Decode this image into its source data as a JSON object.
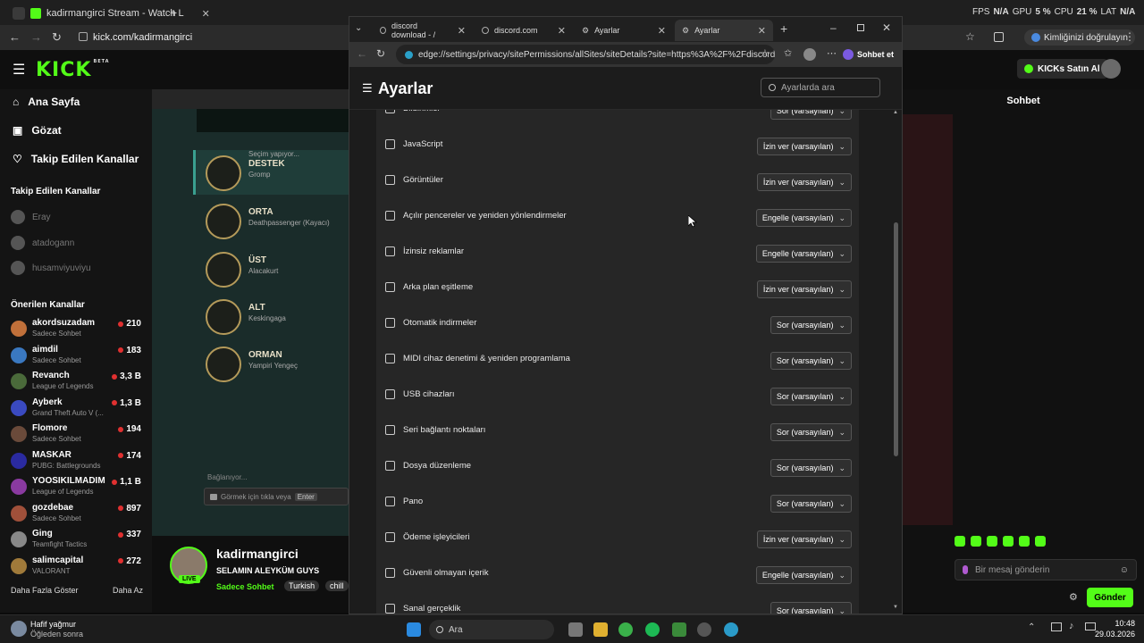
{
  "back_browser": {
    "tab_title": "kadirmangirci Stream - Watch L",
    "url": "kick.com/kadirmangirci",
    "perf": {
      "fps_label": "FPS",
      "fps_value": "N/A",
      "gpu_label": "GPU",
      "gpu_value": "5 %",
      "cpu_label": "CPU",
      "cpu_value": "21 %",
      "lat_label": "LAT",
      "lat_value": "N/A"
    },
    "identity_button": "Kimliğinizi doğrulayın"
  },
  "kick": {
    "logo": "KICK",
    "logo_sup": "BETA",
    "nav": {
      "home": "Ana Sayfa",
      "browse": "Gözat",
      "following": "Takip Edilen Kanallar"
    },
    "followed_title": "Takip Edilen Kanallar",
    "followed": [
      "Eray",
      "atadogann",
      "husamviyuviyu"
    ],
    "recommended_title": "Önerilen Kanallar",
    "recommended": [
      {
        "name": "akordsuzadam",
        "game": "Sadece Sohbet",
        "viewers": "210",
        "color": "#c0703a"
      },
      {
        "name": "aimdil",
        "game": "Sadece Sohbet",
        "viewers": "183",
        "color": "#3a78c0"
      },
      {
        "name": "Revanch",
        "game": "League of Legends",
        "viewers": "3,3 B",
        "color": "#4a6a3a"
      },
      {
        "name": "Ayberk",
        "game": "Grand Theft Auto V (...",
        "viewers": "1,3 B",
        "color": "#3a4ac0"
      },
      {
        "name": "Flomore",
        "game": "Sadece Sohbet",
        "viewers": "194",
        "color": "#6a4a3a"
      },
      {
        "name": "MASKAR",
        "game": "PUBG: Battlegrounds",
        "viewers": "174",
        "color": "#2a2aa0"
      },
      {
        "name": "YOOSIKILMADIM",
        "game": "League of Legends",
        "viewers": "1,1 B",
        "color": "#8a3aa0"
      },
      {
        "name": "gozdebae",
        "game": "Sadece Sohbet",
        "viewers": "897",
        "color": "#a0503a"
      },
      {
        "name": "Ging",
        "game": "Teamfight Tactics",
        "viewers": "337",
        "color": "#888888"
      },
      {
        "name": "salimcapital",
        "game": "VALORANT",
        "viewers": "272",
        "color": "#a07a3a"
      }
    ],
    "show_more": "Daha Fazla Göster",
    "show_less": "Daha Az",
    "kicks_button": "KICKs Satın Al",
    "chat_title": "Sohbet",
    "chat_placeholder": "Bir mesaj gönderin",
    "send_button": "Gönder",
    "streamer": {
      "name": "kadirmangirci",
      "title": "SELAMIN ALEYKÜM GUYS",
      "category": "Sadece Sohbet",
      "tag1": "Turkish",
      "tag2": "chill",
      "live": "LIVE"
    }
  },
  "stream": {
    "roles": [
      {
        "pre": "Seçim yapıyor...",
        "role": "DESTEK",
        "champ": "Gromp"
      },
      {
        "role": "ORTA",
        "champ": "Deathpassenger (Kayacı)"
      },
      {
        "role": "ÜST",
        "champ": "Alacakurt"
      },
      {
        "role": "ALT",
        "champ": "Keskingaga"
      },
      {
        "role": "ORMAN",
        "champ": "Yampiri Yengeç"
      }
    ],
    "connecting": "Bağlanıyor...",
    "chat_hint": "Görmek için tıkla veya",
    "enter_key": "Enter"
  },
  "edge": {
    "tabs": [
      {
        "title": "discord download - /",
        "icon": "search-icon"
      },
      {
        "title": "discord.com",
        "icon": "globe-icon"
      },
      {
        "title": "Ayarlar",
        "icon": "gear-icon"
      },
      {
        "title": "Ayarlar",
        "icon": "gear-icon"
      }
    ],
    "url": "edge://settings/privacy/sitePermissions/allSites/siteDetails?site=https%3A%2F%2Fdiscord....",
    "copilot_button": "Sohbet et",
    "settings_title": "Ayarlar",
    "search_placeholder": "Ayarlarda ara",
    "permissions": [
      {
        "label": "Bildirimler",
        "value": "Sor (varsayılan)",
        "icon": "bell-icon"
      },
      {
        "label": "JavaScript",
        "value": "İzin ver (varsayılan)",
        "icon": "js-icon"
      },
      {
        "label": "Görüntüler",
        "value": "İzin ver (varsayılan)",
        "icon": "image-icon"
      },
      {
        "label": "Açılır pencereler ve yeniden yönlendirmeler",
        "value": "Engelle (varsayılan)",
        "icon": "popup-icon"
      },
      {
        "label": "İzinsiz reklamlar",
        "value": "Engelle (varsayılan)",
        "icon": "ads-icon"
      },
      {
        "label": "Arka plan eşitleme",
        "value": "İzin ver (varsayılan)",
        "icon": "sync-icon"
      },
      {
        "label": "Otomatik indirmeler",
        "value": "Sor (varsayılan)",
        "icon": "download-icon"
      },
      {
        "label": "MIDI cihaz denetimi & yeniden programlama",
        "value": "Sor (varsayılan)",
        "icon": "midi-icon"
      },
      {
        "label": "USB cihazları",
        "value": "Sor (varsayılan)",
        "icon": "usb-icon"
      },
      {
        "label": "Seri bağlantı noktaları",
        "value": "Sor (varsayılan)",
        "icon": "serial-port-icon"
      },
      {
        "label": "Dosya düzenleme",
        "value": "Sor (varsayılan)",
        "icon": "file-edit-icon"
      },
      {
        "label": "Pano",
        "value": "Sor (varsayılan)",
        "icon": "clipboard-icon"
      },
      {
        "label": "Ödeme işleyicileri",
        "value": "İzin ver (varsayılan)",
        "icon": "payment-icon"
      },
      {
        "label": "Güvenli olmayan içerik",
        "value": "Engelle (varsayılan)",
        "icon": "warning-icon"
      },
      {
        "label": "Sanal gerçeklik",
        "value": "Sor (varsayılan)",
        "icon": "vr-icon"
      }
    ]
  },
  "taskbar": {
    "weather_title": "Hafif yağmur",
    "weather_sub": "Öğleden sonra",
    "search": "Ara",
    "time": "10:48",
    "date": "29.03.2026"
  }
}
